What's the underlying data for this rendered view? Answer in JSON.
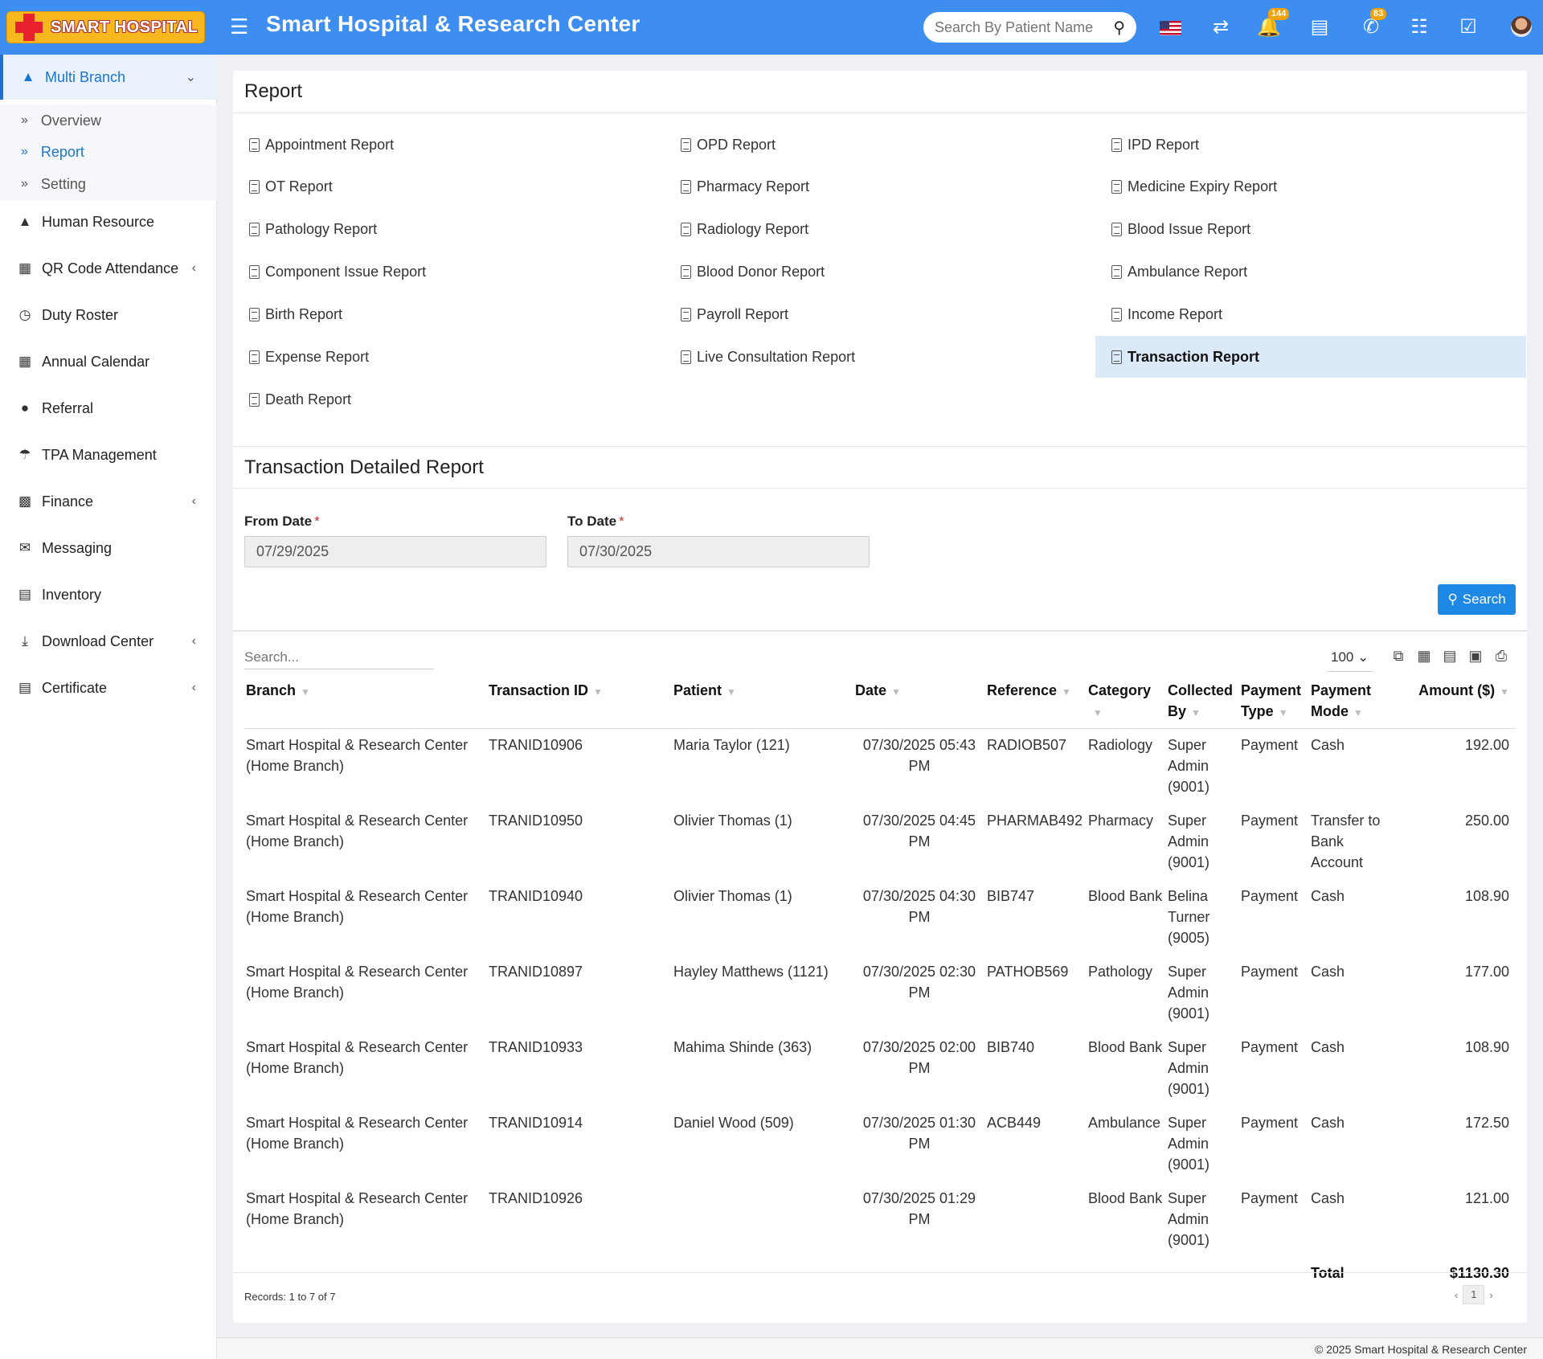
{
  "header": {
    "logo_text": "SMART HOSPITAL",
    "title": "Smart Hospital & Research Center",
    "search_placeholder": "Search By Patient Name",
    "notification_count": "144",
    "whatsapp_count": "83",
    "brand_color": "#3d8ef0"
  },
  "sidebar": {
    "multi_branch": "Multi Branch",
    "sub": [
      "Overview",
      "Report",
      "Setting"
    ],
    "items": [
      "Human Resource",
      "QR Code Attendance",
      "Duty Roster",
      "Annual Calendar",
      "Referral",
      "TPA Management",
      "Finance",
      "Messaging",
      "Inventory",
      "Download Center",
      "Certificate"
    ]
  },
  "report": {
    "title": "Report",
    "links": [
      "Appointment Report",
      "OPD Report",
      "IPD Report",
      "OT Report",
      "Pharmacy Report",
      "Medicine Expiry Report",
      "Pathology Report",
      "Radiology Report",
      "Blood Issue Report",
      "Component Issue Report",
      "Blood Donor Report",
      "Ambulance Report",
      "Birth Report",
      "Payroll Report",
      "Income Report",
      "Expense Report",
      "Live Consultation Report",
      "Transaction Report",
      "Death Report"
    ],
    "selected": "Transaction Report"
  },
  "detail": {
    "title": "Transaction Detailed Report",
    "from_label": "From Date",
    "to_label": "To Date",
    "req": "*",
    "from_value": "07/29/2025",
    "to_value": "07/30/2025",
    "search_button": "Search",
    "table_search_placeholder": "Search...",
    "per_page": "100"
  },
  "table": {
    "headers": [
      "Branch",
      "Transaction ID",
      "Patient",
      "Date",
      "Reference",
      "Category",
      "Collected By",
      "Payment Type",
      "Payment Mode",
      "Amount ($)"
    ],
    "rows": [
      [
        "Smart Hospital & Research Center (Home Branch)",
        "TRANID10906",
        "Maria Taylor (121)",
        "07/30/2025 05:43 PM",
        "RADIOB507",
        "Radiology",
        "Super Admin (9001)",
        "Payment",
        "Cash",
        "192.00"
      ],
      [
        "Smart Hospital & Research Center (Home Branch)",
        "TRANID10950",
        "Olivier Thomas (1)",
        "07/30/2025 04:45 PM",
        "PHARMAB492",
        "Pharmacy",
        "Super Admin (9001)",
        "Payment",
        "Transfer to Bank Account",
        "250.00"
      ],
      [
        "Smart Hospital & Research Center (Home Branch)",
        "TRANID10940",
        "Olivier Thomas (1)",
        "07/30/2025 04:30 PM",
        "BIB747",
        "Blood Bank",
        "Belina Turner (9005)",
        "Payment",
        "Cash",
        "108.90"
      ],
      [
        "Smart Hospital & Research Center (Home Branch)",
        "TRANID10897",
        "Hayley Matthews (1121)",
        "07/30/2025 02:30 PM",
        "PATHOB569",
        "Pathology",
        "Super Admin (9001)",
        "Payment",
        "Cash",
        "177.00"
      ],
      [
        "Smart Hospital & Research Center (Home Branch)",
        "TRANID10933",
        "Mahima Shinde (363)",
        "07/30/2025 02:00 PM",
        "BIB740",
        "Blood Bank",
        "Super Admin (9001)",
        "Payment",
        "Cash",
        "108.90"
      ],
      [
        "Smart Hospital & Research Center (Home Branch)",
        "TRANID10914",
        "Daniel Wood (509)",
        "07/30/2025 01:30 PM",
        "ACB449",
        "Ambulance",
        "Super Admin (9001)",
        "Payment",
        "Cash",
        "172.50"
      ],
      [
        "Smart Hospital & Research Center (Home Branch)",
        "TRANID10926",
        "",
        "07/30/2025 01:29 PM",
        "",
        "Blood Bank",
        "Super Admin (9001)",
        "Payment",
        "Cash",
        "121.00"
      ]
    ],
    "total_label": "Total",
    "total_value": "$1130.30",
    "records": "Records: 1 to 7 of 7",
    "page": "1"
  },
  "footer": "© 2025 Smart Hospital & Research Center"
}
